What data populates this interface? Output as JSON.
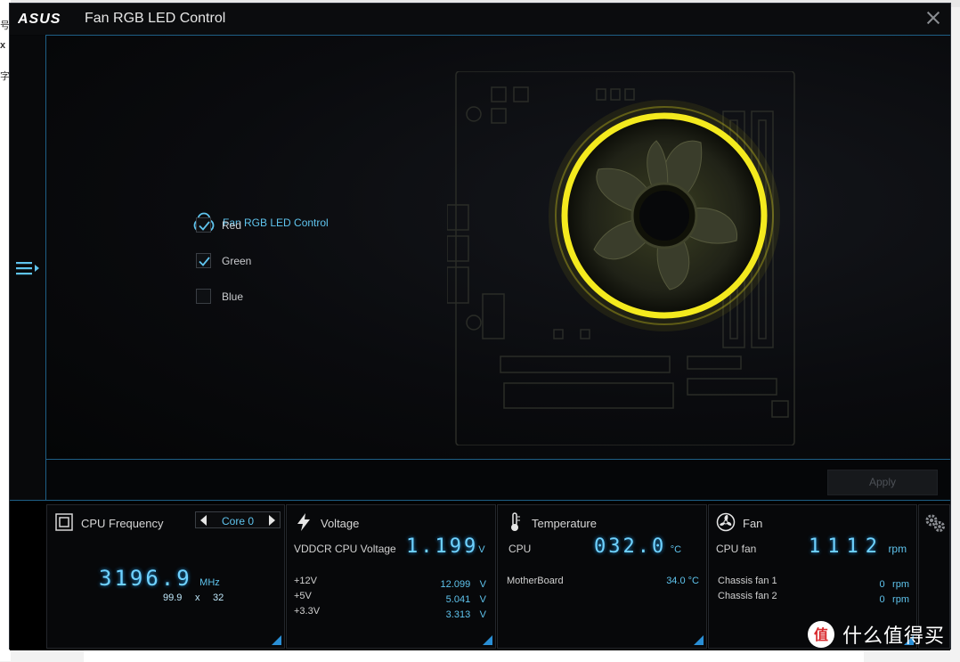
{
  "window": {
    "title": "Fan RGB LED Control",
    "brand": "ASUS"
  },
  "desktop": {
    "left_fragments": [
      "号",
      "x",
      "字"
    ]
  },
  "led_control": {
    "title": "Fan RGB LED Control",
    "options": [
      {
        "label": "Red",
        "checked": true
      },
      {
        "label": "Green",
        "checked": true
      },
      {
        "label": "Blue",
        "checked": false
      }
    ],
    "ring_color": "#f4ea1e"
  },
  "apply_label": "Apply",
  "status": {
    "cpu": {
      "title": "CPU Frequency",
      "core_selector": "Core 0",
      "frequency": "3196.9",
      "frequency_unit": "MHz",
      "bclk": "99.9",
      "times": "x",
      "multiplier": "32"
    },
    "voltage": {
      "title": "Voltage",
      "main_label": "VDDCR CPU Voltage",
      "main_value": "1.199",
      "main_unit": "V",
      "rows": [
        {
          "label": "+12V",
          "value": "12.099",
          "unit": "V"
        },
        {
          "label": "+5V",
          "value": "5.041",
          "unit": "V"
        },
        {
          "label": "+3.3V",
          "value": "3.313",
          "unit": "V"
        }
      ]
    },
    "temperature": {
      "title": "Temperature",
      "main_label": "CPU",
      "main_value": "032.0",
      "main_unit": "°C",
      "rows": [
        {
          "label": "MotherBoard",
          "value": "34.0 °C"
        }
      ]
    },
    "fan": {
      "title": "Fan",
      "main_label": "CPU fan",
      "main_value": "1112",
      "main_unit": "rpm",
      "rows": [
        {
          "label": "Chassis fan 1",
          "value": "0",
          "unit": "rpm"
        },
        {
          "label": "Chassis fan 2",
          "value": "0",
          "unit": "rpm"
        }
      ]
    }
  },
  "watermark": {
    "text": "什么值得买"
  },
  "colors": {
    "accent": "#5fc4ee",
    "frame_line": "#1e5f86",
    "corner_marker": "#2a8fd6"
  }
}
